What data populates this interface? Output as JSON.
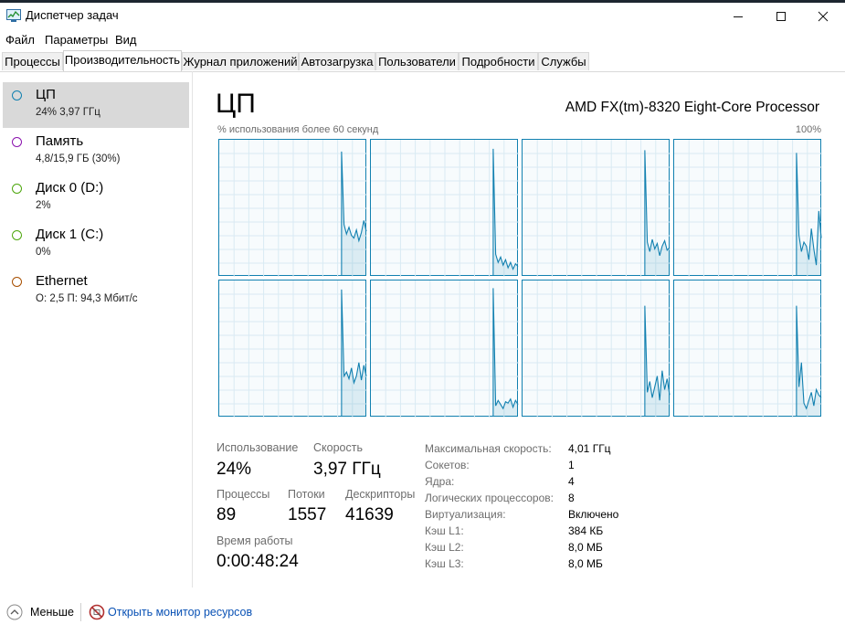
{
  "window": {
    "title": "Диспетчер задач",
    "min_icon": "minimize-icon",
    "max_icon": "maximize-icon",
    "close_icon": "close-icon"
  },
  "menu": [
    "Файл",
    "Параметры",
    "Вид"
  ],
  "tabs": [
    "Процессы",
    "Производительность",
    "Журнал приложений",
    "Автозагрузка",
    "Пользователи",
    "Подробности",
    "Службы"
  ],
  "active_tab": 1,
  "sidebar": [
    {
      "name": "ЦП",
      "sub": "24% 3,97 ГГц",
      "color": "#1180b0",
      "selected": true
    },
    {
      "name": "Память",
      "sub": "4,8/15,9 ГБ (30%)",
      "color": "#8b12ae",
      "selected": false
    },
    {
      "name": "Диск 0 (D:)",
      "sub": "2%",
      "color": "#4da60c",
      "selected": false
    },
    {
      "name": "Диск 1 (C:)",
      "sub": "0%",
      "color": "#4da60c",
      "selected": false
    },
    {
      "name": "Ethernet",
      "sub": "О: 2,5  П: 94,3 Мбит/с",
      "color": "#a74f01",
      "selected": false
    }
  ],
  "main": {
    "title": "ЦП",
    "cpu_model": "AMD FX(tm)-8320 Eight-Core Processor",
    "graph_caption": "% использования более 60 секунд",
    "graph_max": "100%",
    "accent_color": "#1180b0"
  },
  "chart_data": {
    "type": "line",
    "title": "",
    "xlabel": "% использования более 60 секунд",
    "ylabel": "",
    "ylim": [
      0,
      100
    ],
    "grid": true,
    "series": [
      {
        "values": [
          0,
          0,
          0,
          0,
          0,
          0,
          0,
          0,
          0,
          0,
          0,
          0,
          0,
          0,
          0,
          0,
          0,
          0,
          0,
          0,
          0,
          0,
          0,
          0,
          0,
          0,
          0,
          0,
          0,
          0,
          0,
          0,
          0,
          0,
          0,
          0,
          0,
          0,
          0,
          0,
          0,
          0,
          0,
          0,
          0,
          0,
          0,
          0,
          0,
          92,
          38,
          31,
          36,
          30,
          28,
          34,
          26,
          32,
          41,
          33
        ]
      },
      {
        "values": [
          0,
          0,
          0,
          0,
          0,
          0,
          0,
          0,
          0,
          0,
          0,
          0,
          0,
          0,
          0,
          0,
          0,
          0,
          0,
          0,
          0,
          0,
          0,
          0,
          0,
          0,
          0,
          0,
          0,
          0,
          0,
          0,
          0,
          0,
          0,
          0,
          0,
          0,
          0,
          0,
          0,
          0,
          0,
          0,
          0,
          0,
          0,
          0,
          0,
          94,
          16,
          10,
          14,
          8,
          12,
          6,
          10,
          5,
          9,
          7
        ]
      },
      {
        "values": [
          0,
          0,
          0,
          0,
          0,
          0,
          0,
          0,
          0,
          0,
          0,
          0,
          0,
          0,
          0,
          0,
          0,
          0,
          0,
          0,
          0,
          0,
          0,
          0,
          0,
          0,
          0,
          0,
          0,
          0,
          0,
          0,
          0,
          0,
          0,
          0,
          0,
          0,
          0,
          0,
          0,
          0,
          0,
          0,
          0,
          0,
          0,
          0,
          0,
          93,
          25,
          18,
          27,
          20,
          24,
          15,
          22,
          26,
          19,
          21
        ]
      },
      {
        "values": [
          0,
          0,
          0,
          0,
          0,
          0,
          0,
          0,
          0,
          0,
          0,
          0,
          0,
          0,
          0,
          0,
          0,
          0,
          0,
          0,
          0,
          0,
          0,
          0,
          0,
          0,
          0,
          0,
          0,
          0,
          0,
          0,
          0,
          0,
          0,
          0,
          0,
          0,
          0,
          0,
          0,
          0,
          0,
          0,
          0,
          0,
          0,
          0,
          0,
          91,
          30,
          18,
          25,
          22,
          12,
          35,
          20,
          8,
          48,
          28
        ]
      },
      {
        "values": [
          0,
          0,
          0,
          0,
          0,
          0,
          0,
          0,
          0,
          0,
          0,
          0,
          0,
          0,
          0,
          0,
          0,
          0,
          0,
          0,
          0,
          0,
          0,
          0,
          0,
          0,
          0,
          0,
          0,
          0,
          0,
          0,
          0,
          0,
          0,
          0,
          0,
          0,
          0,
          0,
          0,
          0,
          0,
          0,
          0,
          0,
          0,
          0,
          0,
          94,
          30,
          33,
          28,
          36,
          25,
          30,
          40,
          27,
          38,
          30
        ]
      },
      {
        "values": [
          0,
          0,
          0,
          0,
          0,
          0,
          0,
          0,
          0,
          0,
          0,
          0,
          0,
          0,
          0,
          0,
          0,
          0,
          0,
          0,
          0,
          0,
          0,
          0,
          0,
          0,
          0,
          0,
          0,
          0,
          0,
          0,
          0,
          0,
          0,
          0,
          0,
          0,
          0,
          0,
          0,
          0,
          0,
          0,
          0,
          0,
          0,
          0,
          0,
          95,
          8,
          12,
          9,
          6,
          11,
          10,
          13,
          7,
          12,
          9
        ]
      },
      {
        "values": [
          0,
          0,
          0,
          0,
          0,
          0,
          0,
          0,
          0,
          0,
          0,
          0,
          0,
          0,
          0,
          0,
          0,
          0,
          0,
          0,
          0,
          0,
          0,
          0,
          0,
          0,
          0,
          0,
          0,
          0,
          0,
          0,
          0,
          0,
          0,
          0,
          0,
          0,
          0,
          0,
          0,
          0,
          0,
          0,
          0,
          0,
          0,
          0,
          0,
          82,
          18,
          26,
          14,
          22,
          30,
          12,
          34,
          20,
          28,
          16
        ]
      },
      {
        "values": [
          0,
          0,
          0,
          0,
          0,
          0,
          0,
          0,
          0,
          0,
          0,
          0,
          0,
          0,
          0,
          0,
          0,
          0,
          0,
          0,
          0,
          0,
          0,
          0,
          0,
          0,
          0,
          0,
          0,
          0,
          0,
          0,
          0,
          0,
          0,
          0,
          0,
          0,
          0,
          0,
          0,
          0,
          0,
          0,
          0,
          0,
          0,
          0,
          0,
          82,
          22,
          40,
          10,
          6,
          12,
          18,
          8,
          20,
          16,
          14
        ]
      }
    ]
  },
  "stats": {
    "usage_label": "Использование",
    "usage_value": "24%",
    "speed_label": "Скорость",
    "speed_value": "3,97 ГГц",
    "proc_label": "Процессы",
    "proc_value": "89",
    "threads_label": "Потоки",
    "threads_value": "1557",
    "handles_label": "Дескрипторы",
    "handles_value": "41639",
    "uptime_label": "Время работы",
    "uptime_value": "0:00:48:24"
  },
  "specs": [
    {
      "label": "Максимальная скорость:",
      "value": "4,01 ГГц"
    },
    {
      "label": "Сокетов:",
      "value": "1"
    },
    {
      "label": "Ядра:",
      "value": "4"
    },
    {
      "label": "Логических процессоров:",
      "value": "8"
    },
    {
      "label": "Виртуализация:",
      "value": "Включено"
    },
    {
      "label": "Кэш L1:",
      "value": "384 КБ"
    },
    {
      "label": "Кэш L2:",
      "value": "8,0 МБ"
    },
    {
      "label": "Кэш L3:",
      "value": "8,0 МБ"
    }
  ],
  "footer": {
    "less_label": "Меньше",
    "monitor_link": "Открыть монитор ресурсов"
  }
}
